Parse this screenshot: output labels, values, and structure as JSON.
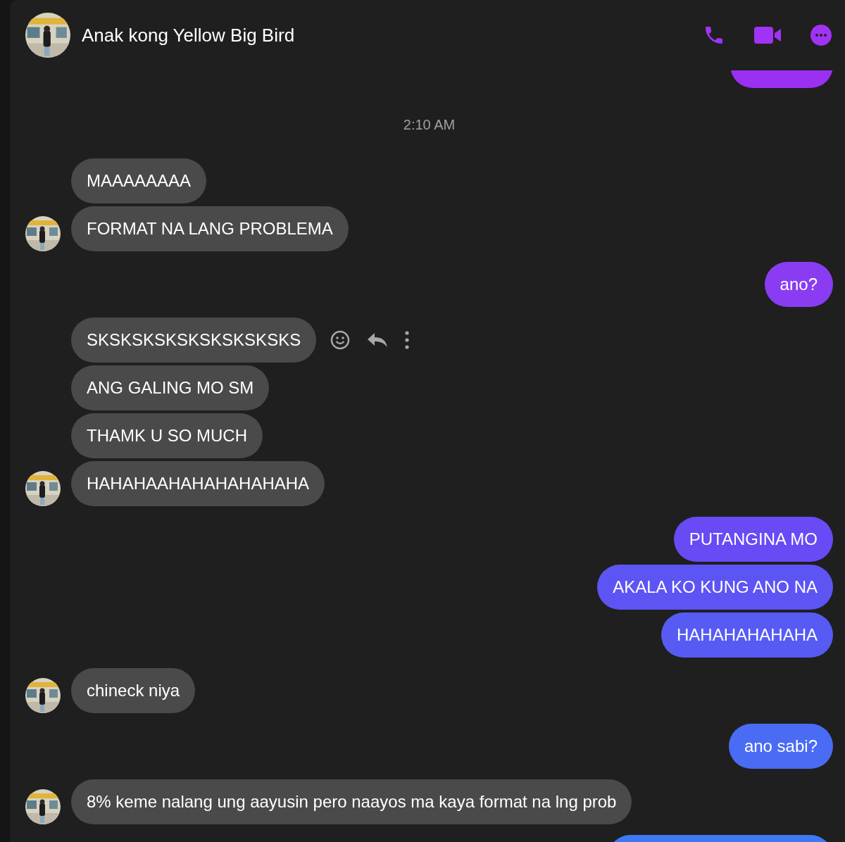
{
  "header": {
    "title": "Anak kong Yellow Big Bird"
  },
  "messages": [
    {
      "kind": "partial_top",
      "color": "#9b30f2"
    },
    {
      "kind": "timestamp",
      "text": "2:10 AM"
    },
    {
      "kind": "incoming",
      "text": "MAAAAAAAA",
      "show_avatar": false,
      "hover_actions": false
    },
    {
      "kind": "incoming",
      "text": "FORMAT NA LANG PROBLEMA",
      "show_avatar": true,
      "hover_actions": false
    },
    {
      "kind": "outgoing",
      "text": "ano?",
      "color": "#8a3cf3"
    },
    {
      "kind": "incoming",
      "text": "SKSKSKSKSKSKSKSKSKS",
      "show_avatar": false,
      "hover_actions": true
    },
    {
      "kind": "incoming",
      "text": "ANG GALING MO SM",
      "show_avatar": false,
      "hover_actions": false
    },
    {
      "kind": "incoming",
      "text": "THAMK U SO MUCH",
      "show_avatar": false,
      "hover_actions": false
    },
    {
      "kind": "incoming",
      "text": "HAHAHAAHAHAHAHAHAHA",
      "show_avatar": true,
      "hover_actions": false
    },
    {
      "kind": "outgoing",
      "text": "PUTANGINA MO",
      "color": "#6a4af4"
    },
    {
      "kind": "outgoing",
      "text": "AKALA KO KUNG ANO NA",
      "color": "#5d54f4"
    },
    {
      "kind": "outgoing",
      "text": "HAHAHAHAHAHA",
      "color": "#575bf4"
    },
    {
      "kind": "incoming",
      "text": "chineck niya",
      "show_avatar": true,
      "hover_actions": false
    },
    {
      "kind": "outgoing",
      "text": "ano sabi?",
      "color": "#4a6cf4"
    },
    {
      "kind": "incoming",
      "text": "8% keme nalang ung aayusin pero naayos ma kaya format na lng prob",
      "show_avatar": true,
      "hover_actions": false
    },
    {
      "kind": "partial_bottom",
      "color": "#3e78f3"
    }
  ]
}
